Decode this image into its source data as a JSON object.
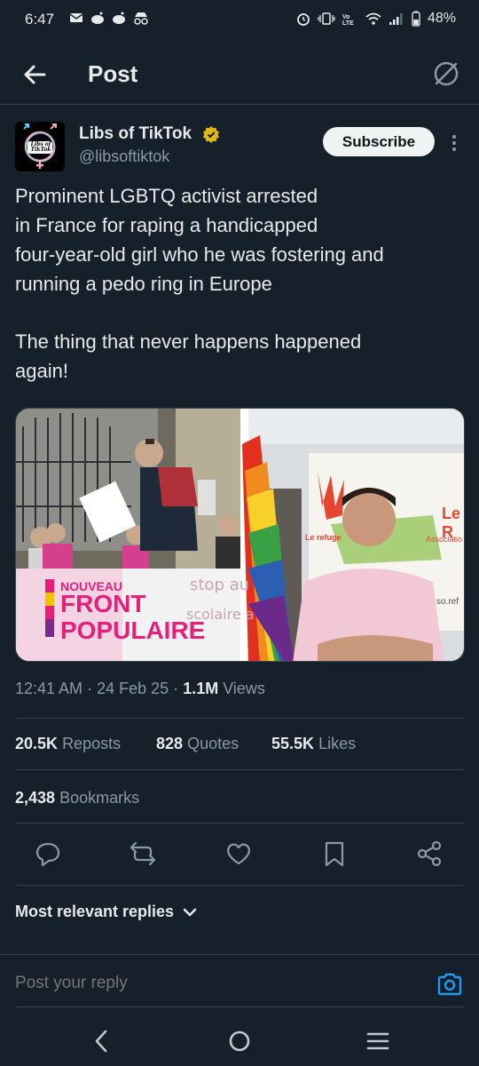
{
  "status": {
    "time": "6:47",
    "battery": "48%",
    "icons": [
      "mail-icon",
      "reddit-icon",
      "reddit-icon",
      "incognito-icon",
      "alarm-icon",
      "vibrate-icon",
      "volte-icon",
      "wifi-icon",
      "signal-icon",
      "battery-icon"
    ]
  },
  "header": {
    "title": "Post"
  },
  "author": {
    "name": "Libs of TikTok",
    "handle": "@libsoftiktok",
    "avatar_text": "Libs of TikTok",
    "subscribe_label": "Subscribe"
  },
  "post": {
    "paragraph1_lines": [
      "Prominent LGBTQ activist arrested",
      "in France for raping a handicapped",
      "four-year-old girl who he was fostering and",
      "running a pedo ring in Europe"
    ],
    "paragraph2_lines": [
      "The thing that never happens happened",
      "again!"
    ],
    "media": {
      "logo_line1": "NOUVEAU",
      "logo_line2": "FRONT",
      "logo_line3": "POPULAIRE",
      "sign_line1": "stop au",
      "sign_line2": "scolaire a",
      "banner_text1": "Le refuge",
      "banner_text2": "Le R",
      "banner_text3": "Associatio",
      "banner_text4": "so.ref"
    }
  },
  "meta": {
    "time": "12:41 AM",
    "sep": "·",
    "date": "24 Feb 25",
    "views_count": "1.1M",
    "views_label": "Views"
  },
  "stats": {
    "reposts_count": "20.5K",
    "reposts_label": "Reposts",
    "quotes_count": "828",
    "quotes_label": "Quotes",
    "likes_count": "55.5K",
    "likes_label": "Likes",
    "bookmarks_count": "2,438",
    "bookmarks_label": "Bookmarks"
  },
  "replies": {
    "sort_label": "Most relevant replies",
    "placeholder": "Post your reply"
  },
  "colors": {
    "background": "#15202b",
    "accent": "#1d9bf0",
    "muted": "#8b98a5",
    "verified": "#e2b719"
  }
}
